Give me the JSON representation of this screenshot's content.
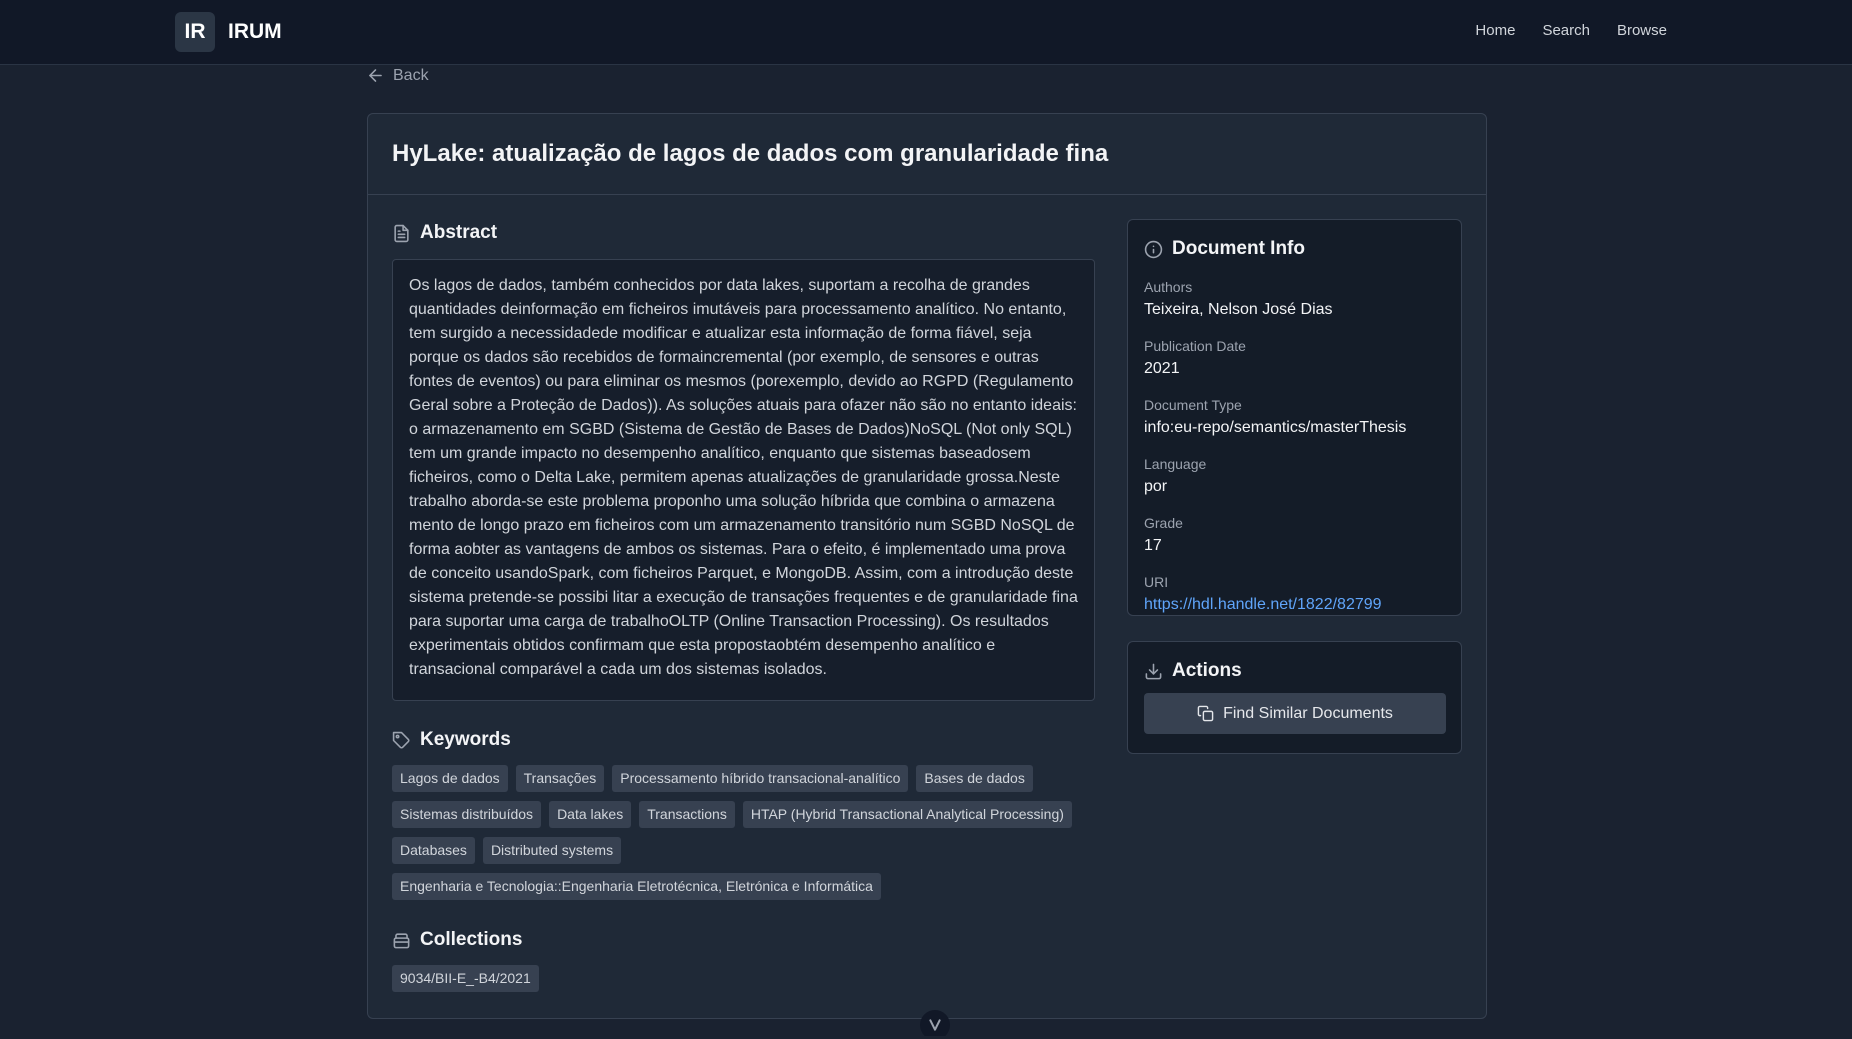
{
  "header": {
    "logo": "IR",
    "name": "IRUM",
    "nav": [
      "Home",
      "Search",
      "Browse"
    ]
  },
  "back_label": "Back",
  "document": {
    "title": "HyLake: atualização de lagos de dados com granularidade fina",
    "abstract_title": "Abstract",
    "abstract": "Os lagos de dados, também conhecidos por data lakes, suportam a recolha de grandes quantidades deinformação em ficheiros imutáveis para processamento analítico. No entanto, tem surgido a necessidadede modificar e atualizar esta informação de forma fiável, seja porque os dados são recebidos de formaincremental (por exemplo, de sensores e outras fontes de eventos) ou para eliminar os mesmos (porexemplo, devido ao RGPD (Regulamento Geral sobre a Proteção de Dados)). As soluções atuais para ofazer não são no entanto ideais: o armazenamento em SGBD (Sistema de Gestão de Bases de Dados)NoSQL (Not only SQL) tem um grande impacto no desempenho analítico, enquanto que sistemas baseadosem ficheiros, como o Delta Lake, permitem apenas atualizações de granularidade grossa.Neste trabalho aborda-se este problema proponho uma solução híbrida que combina o armazena mento de longo prazo em ficheiros com um armazenamento transitório num SGBD NoSQL de forma aobter as vantagens de ambos os sistemas. Para o efeito, é implementado uma prova de conceito usandoSpark, com ficheiros Parquet, e MongoDB. Assim, com a introdução deste sistema pretende-se possibi litar a execução de transações frequentes e de granularidade fina para suportar uma carga de trabalhoOLTP (Online Transaction Processing). Os resultados experimentais obtidos confirmam que esta propostaobtém desempenho analítico e transacional comparável a cada um dos sistemas isolados.",
    "keywords_title": "Keywords",
    "keywords": [
      "Lagos de dados",
      "Transações",
      "Processamento híbrido transacional-analítico",
      "Bases de dados",
      "Sistemas distribuídos",
      "Data lakes",
      "Transactions",
      "HTAP (Hybrid Transactional Analytical Processing)",
      "Databases",
      "Distributed systems",
      "Engenharia e Tecnologia::Engenharia Eletrotécnica, Eletrónica e Informática"
    ],
    "collections_title": "Collections",
    "collections": [
      "9034/BII-E_-B4/2021"
    ]
  },
  "info": {
    "title": "Document Info",
    "authors_label": "Authors",
    "authors": "Teixeira, Nelson José Dias",
    "date_label": "Publication Date",
    "date": "2021",
    "type_label": "Document Type",
    "type": "info:eu-repo/semantics/masterThesis",
    "language_label": "Language",
    "language": "por",
    "grade_label": "Grade",
    "grade": "17",
    "uri_label": "URI",
    "uri": "https://hdl.handle.net/1822/82799"
  },
  "actions": {
    "title": "Actions",
    "find_similar": "Find Similar Documents"
  }
}
